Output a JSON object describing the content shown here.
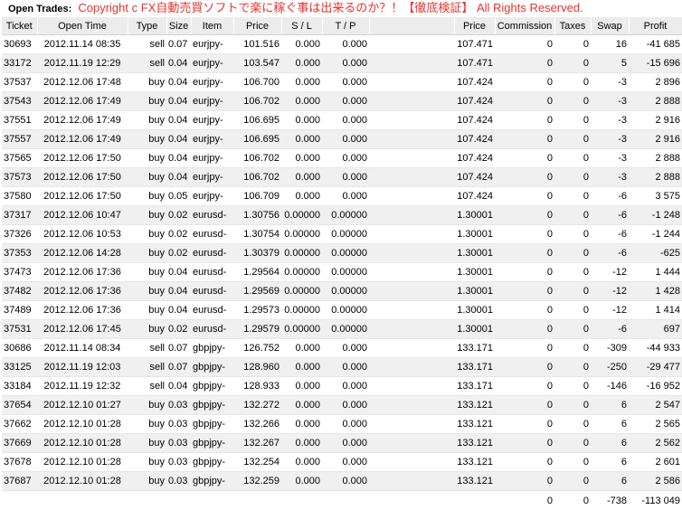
{
  "header": {
    "label": "Open Trades:",
    "copyright": "Copyright c FX自動売買ソフトで楽に稼ぐ事は出来るのか？！【徹底検証】 All Rights Reserved."
  },
  "columns": [
    "Ticket",
    "Open Time",
    "Type",
    "Size",
    "Item",
    "Price",
    "S / L",
    "T / P",
    "",
    "Price",
    "Commission",
    "Taxes",
    "Swap",
    "Profit"
  ],
  "rows": [
    [
      "30693",
      "2012.11.14 08:35",
      "sell",
      "0.07",
      "eurjpy-",
      "101.516",
      "0.000",
      "0.000",
      "",
      "107.471",
      "0",
      "0",
      "16",
      "-41 685"
    ],
    [
      "33172",
      "2012.11.19 12:29",
      "sell",
      "0.04",
      "eurjpy-",
      "103.547",
      "0.000",
      "0.000",
      "",
      "107.471",
      "0",
      "0",
      "5",
      "-15 696"
    ],
    [
      "37537",
      "2012.12.06 17:48",
      "buy",
      "0.04",
      "eurjpy-",
      "106.700",
      "0.000",
      "0.000",
      "",
      "107.424",
      "0",
      "0",
      "-3",
      "2 896"
    ],
    [
      "37543",
      "2012.12.06 17:49",
      "buy",
      "0.04",
      "eurjpy-",
      "106.702",
      "0.000",
      "0.000",
      "",
      "107.424",
      "0",
      "0",
      "-3",
      "2 888"
    ],
    [
      "37551",
      "2012.12.06 17:49",
      "buy",
      "0.04",
      "eurjpy-",
      "106.695",
      "0.000",
      "0.000",
      "",
      "107.424",
      "0",
      "0",
      "-3",
      "2 916"
    ],
    [
      "37557",
      "2012.12.06 17:49",
      "buy",
      "0.04",
      "eurjpy-",
      "106.695",
      "0.000",
      "0.000",
      "",
      "107.424",
      "0",
      "0",
      "-3",
      "2 916"
    ],
    [
      "37565",
      "2012.12.06 17:50",
      "buy",
      "0.04",
      "eurjpy-",
      "106.702",
      "0.000",
      "0.000",
      "",
      "107.424",
      "0",
      "0",
      "-3",
      "2 888"
    ],
    [
      "37573",
      "2012.12.06 17:50",
      "buy",
      "0.04",
      "eurjpy-",
      "106.702",
      "0.000",
      "0.000",
      "",
      "107.424",
      "0",
      "0",
      "-3",
      "2 888"
    ],
    [
      "37580",
      "2012.12.06 17:50",
      "buy",
      "0.05",
      "eurjpy-",
      "106.709",
      "0.000",
      "0.000",
      "",
      "107.424",
      "0",
      "0",
      "-6",
      "3 575"
    ],
    [
      "37317",
      "2012.12.06 10:47",
      "buy",
      "0.02",
      "eurusd-",
      "1.30756",
      "0.00000",
      "0.00000",
      "",
      "1.30001",
      "0",
      "0",
      "-6",
      "-1 248"
    ],
    [
      "37326",
      "2012.12.06 10:53",
      "buy",
      "0.02",
      "eurusd-",
      "1.30754",
      "0.00000",
      "0.00000",
      "",
      "1.30001",
      "0",
      "0",
      "-6",
      "-1 244"
    ],
    [
      "37353",
      "2012.12.06 14:28",
      "buy",
      "0.02",
      "eurusd-",
      "1.30379",
      "0.00000",
      "0.00000",
      "",
      "1.30001",
      "0",
      "0",
      "-6",
      "-625"
    ],
    [
      "37473",
      "2012.12.06 17:36",
      "buy",
      "0.04",
      "eurusd-",
      "1.29564",
      "0.00000",
      "0.00000",
      "",
      "1.30001",
      "0",
      "0",
      "-12",
      "1 444"
    ],
    [
      "37482",
      "2012.12.06 17:36",
      "buy",
      "0.04",
      "eurusd-",
      "1.29569",
      "0.00000",
      "0.00000",
      "",
      "1.30001",
      "0",
      "0",
      "-12",
      "1 428"
    ],
    [
      "37489",
      "2012.12.06 17:36",
      "buy",
      "0.04",
      "eurusd-",
      "1.29573",
      "0.00000",
      "0.00000",
      "",
      "1.30001",
      "0",
      "0",
      "-12",
      "1 414"
    ],
    [
      "37531",
      "2012.12.06 17:45",
      "buy",
      "0.02",
      "eurusd-",
      "1.29579",
      "0.00000",
      "0.00000",
      "",
      "1.30001",
      "0",
      "0",
      "-6",
      "697"
    ],
    [
      "30686",
      "2012.11.14 08:34",
      "sell",
      "0.07",
      "gbpjpy-",
      "126.752",
      "0.000",
      "0.000",
      "",
      "133.171",
      "0",
      "0",
      "-309",
      "-44 933"
    ],
    [
      "33125",
      "2012.11.19 12:03",
      "sell",
      "0.07",
      "gbpjpy-",
      "128.960",
      "0.000",
      "0.000",
      "",
      "133.171",
      "0",
      "0",
      "-250",
      "-29 477"
    ],
    [
      "33184",
      "2012.11.19 12:32",
      "sell",
      "0.04",
      "gbpjpy-",
      "128.933",
      "0.000",
      "0.000",
      "",
      "133.171",
      "0",
      "0",
      "-146",
      "-16 952"
    ],
    [
      "37654",
      "2012.12.10 01:27",
      "buy",
      "0.03",
      "gbpjpy-",
      "132.272",
      "0.000",
      "0.000",
      "",
      "133.121",
      "0",
      "0",
      "6",
      "2 547"
    ],
    [
      "37662",
      "2012.12.10 01:28",
      "buy",
      "0.03",
      "gbpjpy-",
      "132.266",
      "0.000",
      "0.000",
      "",
      "133.121",
      "0",
      "0",
      "6",
      "2 565"
    ],
    [
      "37669",
      "2012.12.10 01:28",
      "buy",
      "0.03",
      "gbpjpy-",
      "132.267",
      "0.000",
      "0.000",
      "",
      "133.121",
      "0",
      "0",
      "6",
      "2 562"
    ],
    [
      "37678",
      "2012.12.10 01:28",
      "buy",
      "0.03",
      "gbpjpy-",
      "132.254",
      "0.000",
      "0.000",
      "",
      "133.121",
      "0",
      "0",
      "6",
      "2 601"
    ],
    [
      "37687",
      "2012.12.10 01:28",
      "buy",
      "0.03",
      "gbpjpy-",
      "132.259",
      "0.000",
      "0.000",
      "",
      "133.121",
      "0",
      "0",
      "6",
      "2 586"
    ]
  ],
  "totals": {
    "commission": "0",
    "taxes": "0",
    "swap": "-738",
    "profit": "-113 049"
  }
}
